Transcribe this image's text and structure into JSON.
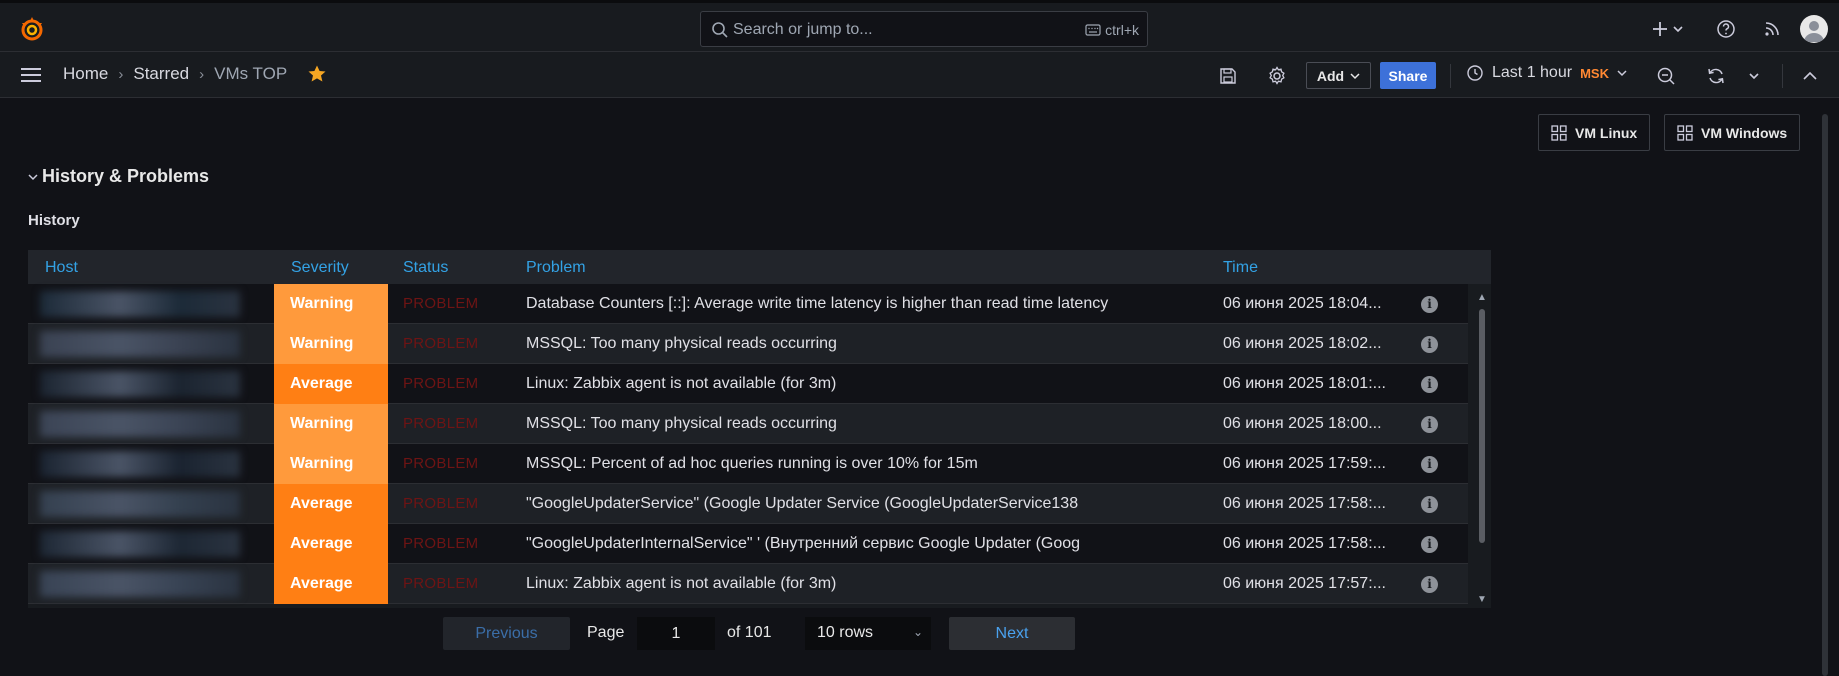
{
  "topbar": {
    "search_placeholder": "Search or jump to...",
    "search_shortcut": "ctrl+k"
  },
  "navbar": {
    "breadcrumbs": [
      "Home",
      "Starred",
      "VMs TOP"
    ],
    "add_label": "Add",
    "share_label": "Share",
    "time_range": "Last 1 hour",
    "timezone": "MSK"
  },
  "dashboard_links": [
    "VM Linux",
    "VM Windows"
  ],
  "row_title": "History & Problems",
  "panel_title": "History",
  "table": {
    "columns": [
      "Host",
      "Severity",
      "Status",
      "Problem",
      "Time"
    ],
    "rows": [
      {
        "severity": "Warning",
        "status": "PROBLEM",
        "problem": "Database Counters [::]: Average write time latency is higher than read time latency",
        "time": "06 июня 2025 18:04..."
      },
      {
        "severity": "Warning",
        "status": "PROBLEM",
        "problem": "MSSQL: Too many physical reads occurring",
        "time": "06 июня 2025 18:02..."
      },
      {
        "severity": "Average",
        "status": "PROBLEM",
        "problem": "Linux: Zabbix agent is not available (for 3m)",
        "time": "06 июня 2025 18:01:..."
      },
      {
        "severity": "Warning",
        "status": "PROBLEM",
        "problem": "MSSQL: Too many physical reads occurring",
        "time": "06 июня 2025 18:00..."
      },
      {
        "severity": "Warning",
        "status": "PROBLEM",
        "problem": "MSSQL: Percent of ad hoc queries running is over 10% for 15m",
        "time": "06 июня 2025 17:59:..."
      },
      {
        "severity": "Average",
        "status": "PROBLEM",
        "problem": "\"GoogleUpdaterService\" (Google Updater Service (GoogleUpdaterService138",
        "time": "06 июня 2025 17:58:..."
      },
      {
        "severity": "Average",
        "status": "PROBLEM",
        "problem": "\"GoogleUpdaterInternalService\" ' (Внутренний сервис Google Updater (Goog",
        "time": "06 июня 2025 17:58:..."
      },
      {
        "severity": "Average",
        "status": "PROBLEM",
        "problem": "Linux: Zabbix agent is not available (for 3m)",
        "time": "06 июня 2025 17:57:..."
      }
    ]
  },
  "pager": {
    "previous": "Previous",
    "page_label": "Page",
    "page_value": "1",
    "of_label": "of 101",
    "rows_select": "10 rows",
    "next": "Next"
  },
  "colors": {
    "accent": "#3d71d9",
    "warning": "#ff9a3c",
    "average": "#ff7f14",
    "header_text": "#33a2e5",
    "status_problem": "#6e1414"
  }
}
